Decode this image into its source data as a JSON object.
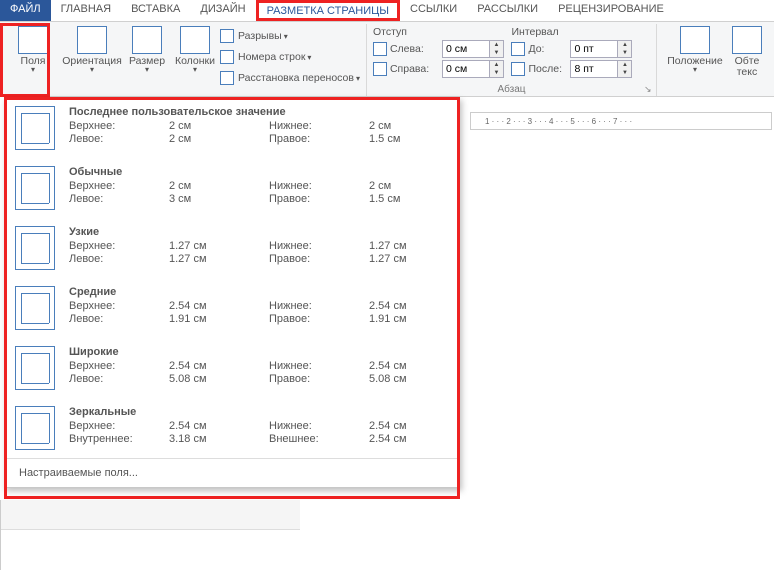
{
  "tabs": {
    "file": "ФАЙЛ",
    "home": "ГЛАВНАЯ",
    "insert": "ВСТАВКА",
    "design": "ДИЗАЙН",
    "layout": "РАЗМЕТКА СТРАНИЦЫ",
    "references": "ССЫЛКИ",
    "mailings": "РАССЫЛКИ",
    "review": "РЕЦЕНЗИРОВАНИЕ"
  },
  "ribbon": {
    "polya": "Поля",
    "orientation": "Ориентация",
    "size": "Размер",
    "columns": "Колонки",
    "breaks": "Разрывы",
    "line_numbers": "Номера строк",
    "hyphenation": "Расстановка переносов",
    "indent_header": "Отступ",
    "indent_left_lbl": "Слева:",
    "indent_right_lbl": "Справа:",
    "indent_left_val": "0 см",
    "indent_right_val": "0 см",
    "spacing_header": "Интервал",
    "spacing_before_lbl": "До:",
    "spacing_after_lbl": "После:",
    "spacing_before_val": "0 пт",
    "spacing_after_val": "8 пт",
    "paragraph_group": "Абзац",
    "position": "Положение",
    "wrap": "Обте\nтекс"
  },
  "dropdown": {
    "items": [
      {
        "title": "Последнее пользовательское значение",
        "top_l": "Верхнее:",
        "top_v": "2 см",
        "bot_l": "Нижнее:",
        "bot_v": "2 см",
        "left_l": "Левое:",
        "left_v": "2 см",
        "right_l": "Правое:",
        "right_v": "1.5 см"
      },
      {
        "title": "Обычные",
        "top_l": "Верхнее:",
        "top_v": "2 см",
        "bot_l": "Нижнее:",
        "bot_v": "2 см",
        "left_l": "Левое:",
        "left_v": "3 см",
        "right_l": "Правое:",
        "right_v": "1.5 см"
      },
      {
        "title": "Узкие",
        "top_l": "Верхнее:",
        "top_v": "1.27 см",
        "bot_l": "Нижнее:",
        "bot_v": "1.27 см",
        "left_l": "Левое:",
        "left_v": "1.27 см",
        "right_l": "Правое:",
        "right_v": "1.27 см"
      },
      {
        "title": "Средние",
        "top_l": "Верхнее:",
        "top_v": "2.54 см",
        "bot_l": "Нижнее:",
        "bot_v": "2.54 см",
        "left_l": "Левое:",
        "left_v": "1.91 см",
        "right_l": "Правое:",
        "right_v": "1.91 см"
      },
      {
        "title": "Широкие",
        "top_l": "Верхнее:",
        "top_v": "2.54 см",
        "bot_l": "Нижнее:",
        "bot_v": "2.54 см",
        "left_l": "Левое:",
        "left_v": "5.08 см",
        "right_l": "Правое:",
        "right_v": "5.08 см"
      },
      {
        "title": "Зеркальные",
        "top_l": "Верхнее:",
        "top_v": "2.54 см",
        "bot_l": "Нижнее:",
        "bot_v": "2.54 см",
        "left_l": "Внутреннее:",
        "left_v": "3.18 см",
        "right_l": "Внешнее:",
        "right_v": "2.54 см"
      }
    ],
    "custom": "Настраиваемые поля..."
  },
  "ruler": {
    "ticks": "1 · · · 2 · · · 3 · · · 4 · · · 5 · · · 6 · · · 7 · · ·"
  }
}
